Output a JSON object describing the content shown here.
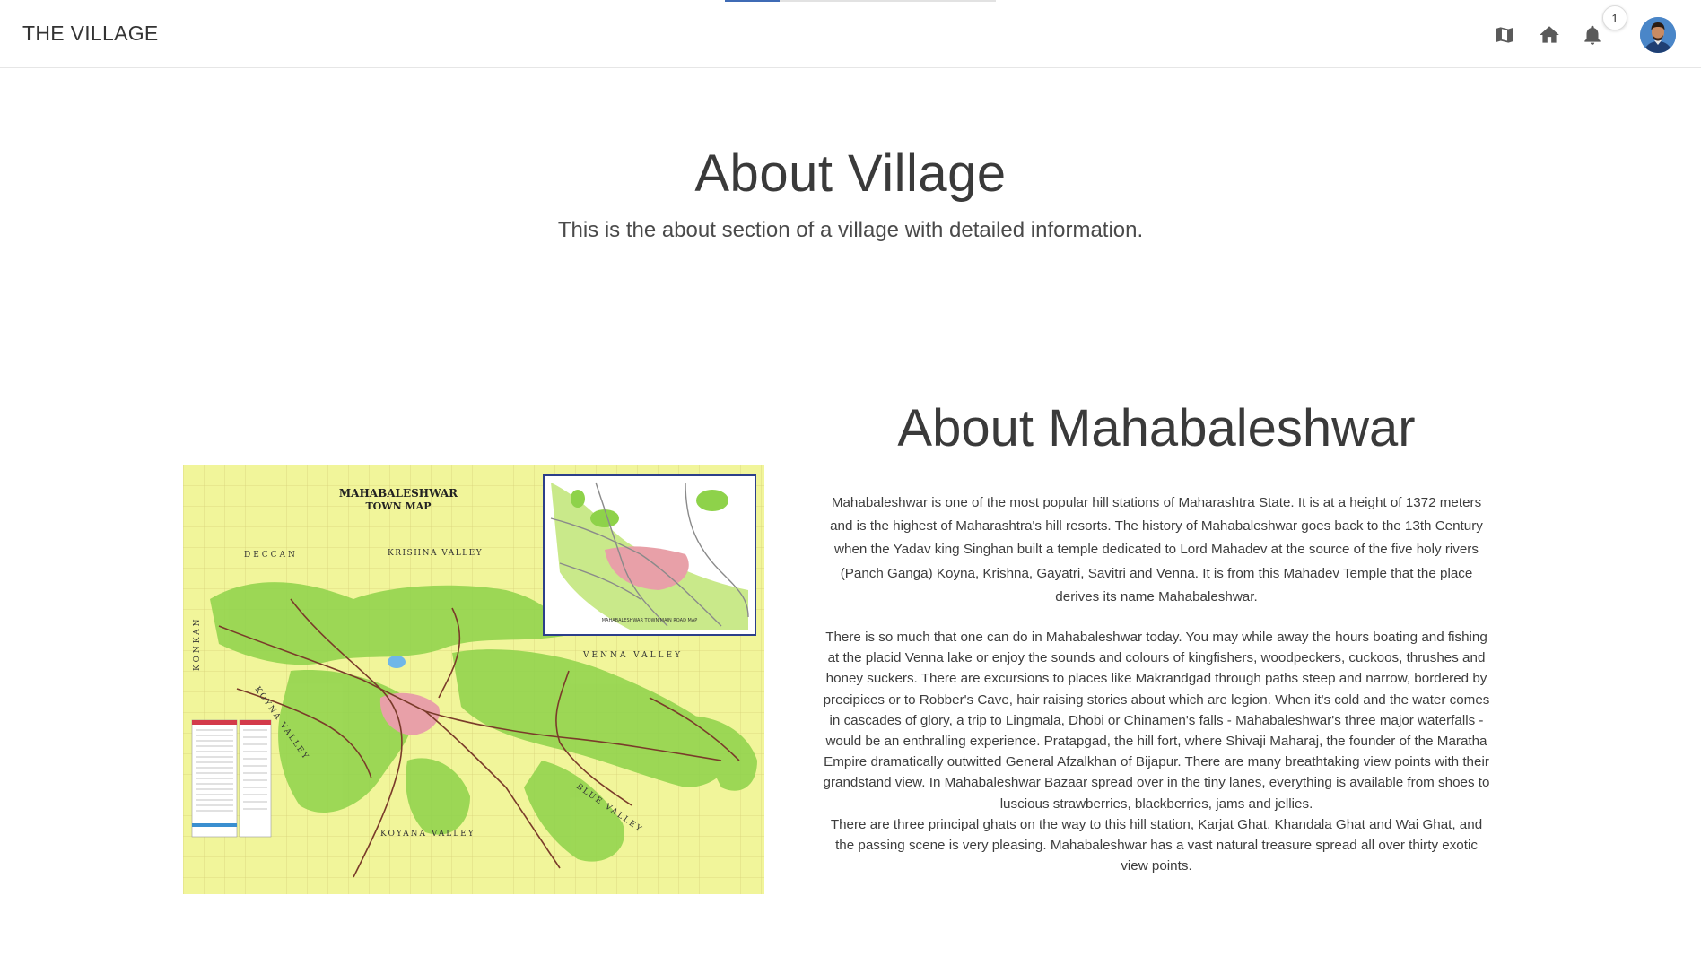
{
  "header": {
    "brand": "THE VILLAGE",
    "tabs_count_visible": 1,
    "icons": [
      {
        "name": "map-icon",
        "glyph": "map"
      },
      {
        "name": "home-icon",
        "glyph": "home"
      },
      {
        "name": "bell-icon",
        "glyph": "notifications"
      }
    ],
    "notification_count": "1",
    "accent_color": "#3f6bb5"
  },
  "hero": {
    "title": "About Village",
    "subtitle": "This is the about section of a village with detailed information."
  },
  "about": {
    "title": "About Mahabaleshwar",
    "paragraph1": "Mahabaleshwar is one of the most popular hill stations of Maharashtra State. It is at a height of 1372 meters and is the highest of Maharashtra's hill resorts. The history of Mahabaleshwar goes back to the 13th Century when the Yadav king Singhan built a temple dedicated to Lord Mahadev at the source of the five holy rivers (Panch Ganga) Koyna, Krishna, Gayatri, Savitri and Venna. It is from this Mahadev Temple that the place derives its name Mahabaleshwar.",
    "paragraph2": "There is so much that one can do in Mahabaleshwar today. You may while away the hours boating and fishing at the placid Venna lake or enjoy the sounds and colours of kingfishers, woodpeckers, cuckoos, thrushes and honey suckers. There are excursions to places like Makrandgad through paths steep and narrow, bordered by precipices or to Robber's Cave, hair raising stories about which are legion. When it's cold and the water comes in cascades of glory, a trip to Lingmala, Dhobi or Chinamen's falls - Mahabaleshwar's three major waterfalls - would be an enthralling experience. Pratapgad, the hill fort, where Shivaji Maharaj, the founder of the Maratha Empire dramatically outwitted General Afzalkhan of Bijapur. There are many breathtaking view points with their grandstand view. In Mahabaleshwar Bazaar spread over in the tiny lanes, everything is available from shoes to luscious strawberries, blackberries, jams and jellies.",
    "paragraph3": "There are three principal ghats on the way to this hill station, Karjat Ghat, Khandala Ghat and Wai Ghat, and the passing scene is very pleasing. Mahabaleshwar has a vast natural treasure spread all over thirty exotic view points."
  },
  "map": {
    "title_line1": "MAHABALESHWAR",
    "title_line2": "TOWN MAP",
    "labels": {
      "deccan": "DECCAN",
      "krishna_valley": "KRISHNA VALLEY",
      "venna_valley": "VENNA VALLEY",
      "konkan": "KONKAN",
      "koyna_valley_side": "KOYNA VALLEY",
      "koyna_valley_bottom": "KOYANA VALLEY",
      "blue_valley": "BLUE VALLEY",
      "inset_caption": "MAHABALESHWAR TOWN MAIN ROAD MAP"
    },
    "colors": {
      "base": "#f1f59a",
      "vegetation": "#8ed24a",
      "town": "#e8a0a8",
      "roads": "#7a3b2a",
      "inset_border": "#2c3f8a"
    }
  }
}
